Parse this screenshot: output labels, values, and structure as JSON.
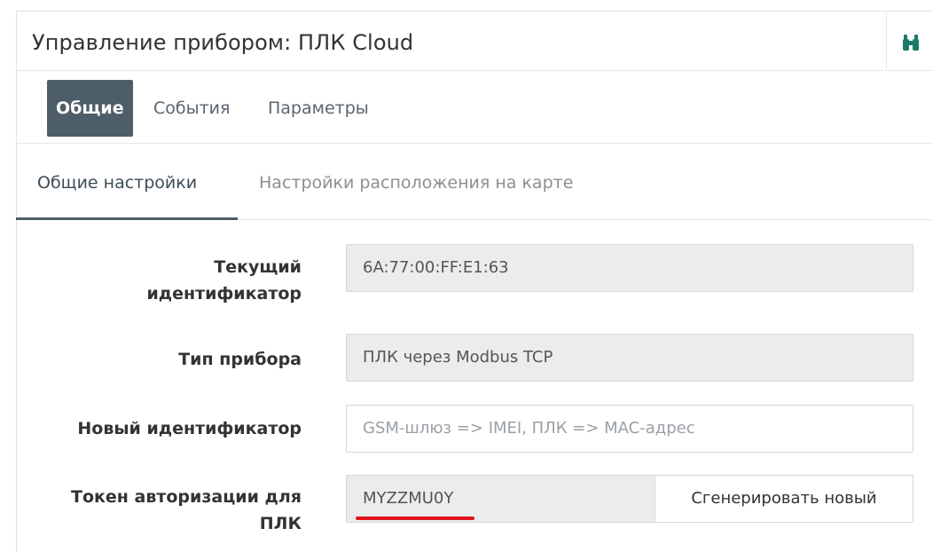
{
  "header": {
    "title": "Управление прибором: ПЛК Cloud",
    "search_icon": "binoculars-icon"
  },
  "subnav": {
    "items": [
      {
        "label": "Общие",
        "active": true
      },
      {
        "label": "События",
        "active": false
      },
      {
        "label": "Параметры",
        "active": false
      }
    ]
  },
  "tabs": [
    {
      "label": "Общие настройки",
      "active": true
    },
    {
      "label": "Настройки расположения на карте",
      "active": false
    }
  ],
  "form": {
    "current_id": {
      "label_line1": "Текущий",
      "label_line2": "идентификатор",
      "value": "6A:77:00:FF:E1:63"
    },
    "device_type": {
      "label": "Тип прибора",
      "value": "ПЛК через Modbus TCP"
    },
    "new_id": {
      "label": "Новый идентификатор",
      "placeholder": "GSM-шлюз => IMEI, ПЛК => MAC-адрес"
    },
    "token": {
      "label_line1": "Токен авторизации для",
      "label_line2": "ПЛК",
      "value": "MYZZMU0Y",
      "button": "Сгенерировать новый"
    }
  },
  "colors": {
    "accent": "#4d5e68",
    "highlight": "#e0141c",
    "icon": "#1a7a6a"
  }
}
